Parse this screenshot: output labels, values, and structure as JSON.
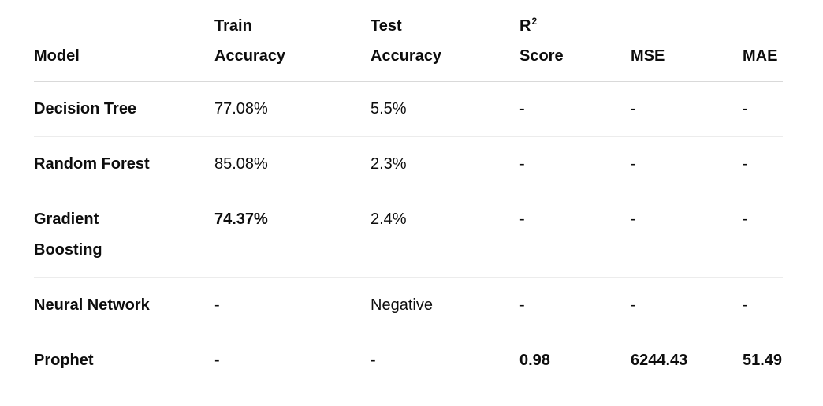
{
  "table": {
    "headers": {
      "model": [
        "",
        "Model"
      ],
      "train_accuracy": [
        "Train",
        "Accuracy"
      ],
      "test_accuracy": [
        "Test",
        "Accuracy"
      ],
      "r2_score": [
        "R",
        "2",
        "Score"
      ],
      "mse": [
        "",
        "MSE"
      ],
      "mae": [
        "",
        "MAE"
      ]
    },
    "rows": [
      {
        "model": [
          "Decision Tree"
        ],
        "train_accuracy": "77.08%",
        "test_accuracy": "5.5%",
        "r2_score": "-",
        "mse": "-",
        "mae": "-"
      },
      {
        "model": [
          "Random Forest"
        ],
        "train_accuracy": "85.08%",
        "test_accuracy": "2.3%",
        "r2_score": "-",
        "mse": "-",
        "mae": "-"
      },
      {
        "model": [
          "Gradient",
          "Boosting"
        ],
        "train_accuracy": "74.37%",
        "test_accuracy": "2.4%",
        "r2_score": "-",
        "mse": "-",
        "mae": "-"
      },
      {
        "model": [
          "Neural Network"
        ],
        "train_accuracy": "-",
        "test_accuracy": "Negative",
        "r2_score": "-",
        "mse": "-",
        "mae": "-"
      },
      {
        "model": [
          "Prophet"
        ],
        "train_accuracy": "-",
        "test_accuracy": "-",
        "r2_score": "0.98",
        "mse": "6244.43",
        "mae": "51.49"
      }
    ]
  }
}
